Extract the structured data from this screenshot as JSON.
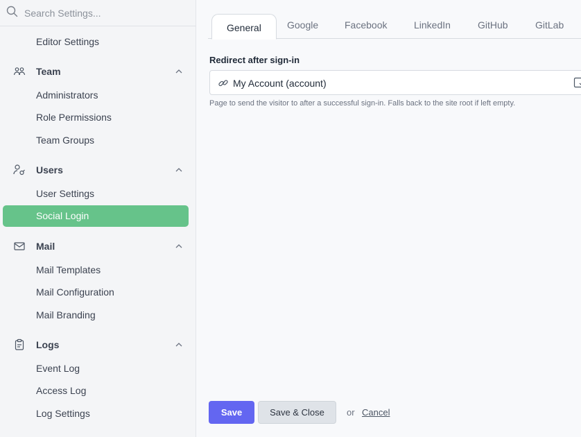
{
  "search": {
    "placeholder": "Search Settings..."
  },
  "sidebar": {
    "editor_settings": "Editor Settings",
    "team": {
      "title": "Team",
      "items": [
        "Administrators",
        "Role Permissions",
        "Team Groups"
      ]
    },
    "users": {
      "title": "Users",
      "items": [
        "User Settings",
        "Social Login"
      ]
    },
    "mail": {
      "title": "Mail",
      "items": [
        "Mail Templates",
        "Mail Configuration",
        "Mail Branding"
      ]
    },
    "logs": {
      "title": "Logs",
      "items": [
        "Event Log",
        "Access Log",
        "Log Settings"
      ]
    },
    "active_item": "Social Login",
    "active_color": "#66c38a"
  },
  "main": {
    "tabs": [
      "General",
      "Google",
      "Facebook",
      "LinkedIn",
      "GitHub",
      "GitLab"
    ],
    "active_tab": "General",
    "field_label": "Redirect after sign-in",
    "field_value": "My Account (account)",
    "help_text": "Page to send the visitor to after a successful sign-in. Falls back to the site root if left empty.",
    "save_label": "Save",
    "save_close_label": "Save & Close",
    "or_text": "or",
    "cancel_label": "Cancel",
    "accent_color": "#6366f1"
  }
}
